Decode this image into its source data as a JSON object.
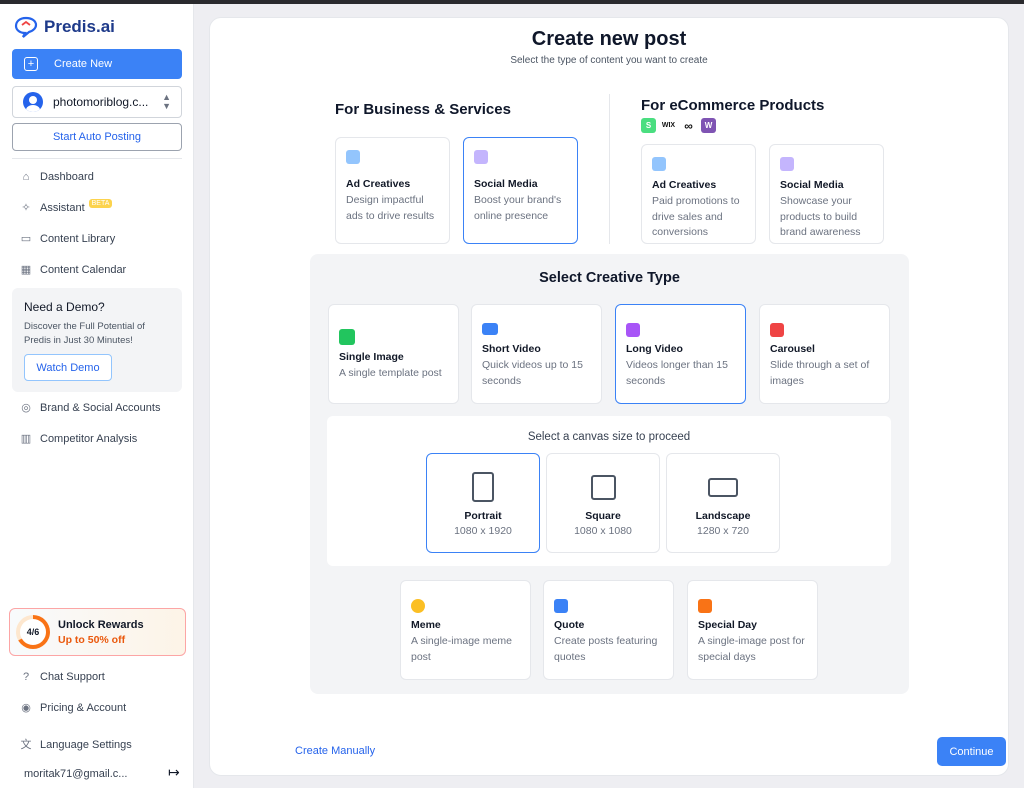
{
  "app": {
    "name": "Predis.ai"
  },
  "sidebar": {
    "create_new": "Create New",
    "account": "photomoriblog.c...",
    "start_auto_posting": "Start Auto Posting",
    "nav": [
      {
        "label": "Dashboard",
        "icon": "home-icon"
      },
      {
        "label": "Assistant",
        "icon": "sparkle-icon",
        "badge": "BETA"
      },
      {
        "label": "Content Library",
        "icon": "library-icon"
      },
      {
        "label": "Content Calendar",
        "icon": "calendar-icon"
      }
    ],
    "demo": {
      "title": "Need a Demo?",
      "description": "Discover the Full Potential of Predis in Just 30 Minutes!",
      "button": "Watch Demo"
    },
    "nav2": [
      {
        "label": "Brand & Social Accounts",
        "icon": "fingerprint-icon"
      },
      {
        "label": "Competitor Analysis",
        "icon": "bar-chart-icon"
      }
    ],
    "rewards": {
      "progress": "4/6",
      "title": "Unlock Rewards",
      "subtitle": "Up to 50% off"
    },
    "bottom": [
      {
        "label": "Chat Support",
        "icon": "help-icon"
      },
      {
        "label": "Pricing & Account",
        "icon": "user-circle-icon"
      },
      {
        "label": "Language Settings",
        "icon": "translate-icon"
      }
    ],
    "email": "moritak71@gmail.c..."
  },
  "main": {
    "title": "Create new post",
    "subtitle": "Select the type of content you want to create",
    "business": {
      "heading": "For Business & Services",
      "cards": [
        {
          "title": "Ad Creatives",
          "desc": "Design impactful ads to drive results",
          "selected": false
        },
        {
          "title": "Social Media",
          "desc": "Boost your brand's online presence",
          "selected": true
        }
      ]
    },
    "ecommerce": {
      "heading": "For eCommerce Products",
      "platforms": [
        "shopify",
        "wix",
        "squarespace",
        "woocommerce"
      ],
      "platform_glyphs": {
        "wix": "WIX",
        "woo": "W"
      },
      "cards": [
        {
          "title": "Ad Creatives",
          "desc": "Paid promotions to drive sales and conversions"
        },
        {
          "title": "Social Media",
          "desc": "Showcase your products to build brand awareness"
        }
      ]
    },
    "creative_type": {
      "heading": "Select Creative Type",
      "types": [
        {
          "title": "Single Image",
          "desc": "A single template post",
          "icon": "image-icon",
          "color": "#22c55e"
        },
        {
          "title": "Short Video",
          "desc": "Quick videos up to 15 seconds",
          "icon": "video-icon",
          "color": "#3b82f6"
        },
        {
          "title": "Long Video",
          "desc": "Videos longer than 15 seconds",
          "icon": "clapperboard-icon",
          "color": "#a855f7",
          "selected": true
        },
        {
          "title": "Carousel",
          "desc": "Slide through a set of images",
          "icon": "carousel-icon",
          "color": "#ef4444"
        }
      ],
      "canvas": {
        "heading": "Select a canvas size to proceed",
        "sizes": [
          {
            "name": "Portrait",
            "dim": "1080 x 1920",
            "selected": true
          },
          {
            "name": "Square",
            "dim": "1080 x 1080"
          },
          {
            "name": "Landscape",
            "dim": "1280 x 720"
          }
        ]
      },
      "more": [
        {
          "title": "Meme",
          "desc": "A single-image meme post",
          "icon": "emoji-icon",
          "color": "#fbbf24"
        },
        {
          "title": "Quote",
          "desc": "Create posts featuring quotes",
          "icon": "quote-icon",
          "color": "#3b82f6"
        },
        {
          "title": "Special Day",
          "desc": "A single-image post for special days",
          "icon": "party-icon",
          "color": "#f97316"
        }
      ]
    },
    "create_manually": "Create Manually",
    "continue": "Continue"
  },
  "colors": {
    "accent": "#3b82f6",
    "brand": "#1e3a8a",
    "reward": "#ea580c"
  }
}
